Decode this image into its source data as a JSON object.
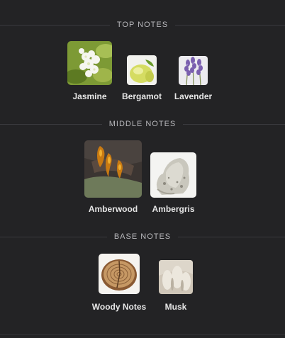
{
  "sections": {
    "top": {
      "title": "TOP NOTES",
      "notes": [
        {
          "label": "Jasmine",
          "icon": "jasmine-image"
        },
        {
          "label": "Bergamot",
          "icon": "bergamot-image"
        },
        {
          "label": "Lavender",
          "icon": "lavender-image"
        }
      ]
    },
    "middle": {
      "title": "MIDDLE NOTES",
      "notes": [
        {
          "label": "Amberwood",
          "icon": "amberwood-image"
        },
        {
          "label": "Ambergris",
          "icon": "ambergris-image"
        }
      ]
    },
    "base": {
      "title": "BASE NOTES",
      "notes": [
        {
          "label": "Woody Notes",
          "icon": "woody-notes-image"
        },
        {
          "label": "Musk",
          "icon": "musk-image"
        }
      ]
    }
  }
}
